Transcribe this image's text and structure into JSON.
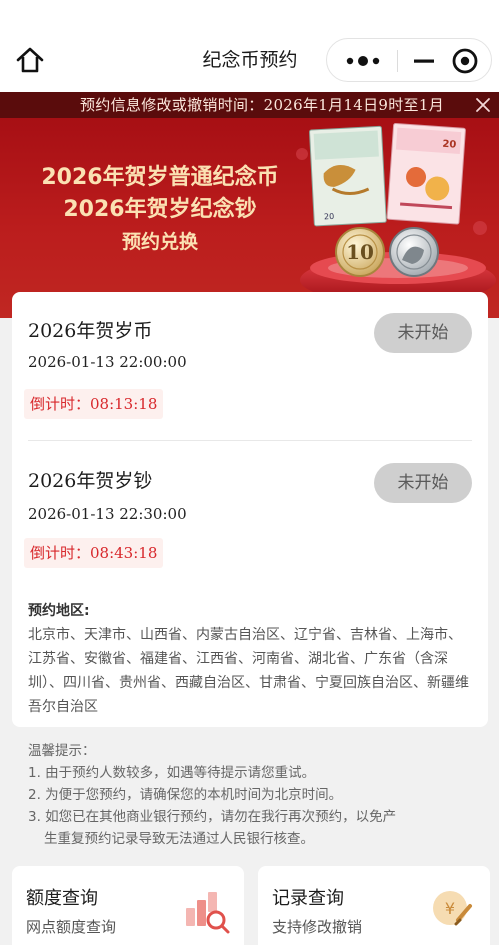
{
  "nav": {
    "title": "纪念币预约",
    "home_icon": "home-icon",
    "more_icon": "more-dots-icon",
    "minimize_icon": "minimize-icon",
    "close_icon": "target-close-icon"
  },
  "notice": {
    "text": "预约信息修改或撤销时间：2026年1月14日9时至1月",
    "close_icon": "close-icon"
  },
  "banner": {
    "line1": "2026年贺岁普通纪念币",
    "line2": "2026年贺岁纪念钞",
    "line3": "预约兑换",
    "coin_value": "10",
    "note_value": "20"
  },
  "appointments": [
    {
      "name": "2026年贺岁币",
      "time": "2026-01-13 22:00:00",
      "countdown": "倒计时：08:13:18",
      "status": "未开始"
    },
    {
      "name": "2026年贺岁钞",
      "time": "2026-01-13 22:30:00",
      "countdown": "倒计时：08:43:18",
      "status": "未开始"
    }
  ],
  "region": {
    "title": "预约地区:",
    "text": "北京市、天津市、山西省、内蒙古自治区、辽宁省、吉林省、上海市、江苏省、安徽省、福建省、江西省、河南省、湖北省、广东省（含深圳）、四川省、贵州省、西藏自治区、甘肃省、宁夏回族自治区、新疆维吾尔自治区"
  },
  "tips": {
    "title": "温馨提示：",
    "items": [
      "1. 由于预约人数较多，如遇等待提示请您重试。",
      "2. 为便于您预约，请确保您的本机时间为北京时间。",
      "3. 如您已在其他商业银行预约，请勿在我行再次预约，以免产",
      "生重复预约记录导致无法通过人民银行核查。"
    ]
  },
  "bottom_cards": [
    {
      "title": "额度查询",
      "subtitle": "网点额度查询",
      "icon": "quota-search-icon"
    },
    {
      "title": "记录查询",
      "subtitle": "支持修改撤销",
      "icon": "record-coin-icon"
    }
  ],
  "colors": {
    "brand_red": "#b3161a",
    "notice_bg": "#5a0c0c",
    "countdown_red": "#d8282c",
    "status_gray": "#cfcfcf",
    "banner_gold": "#fbe1b3"
  }
}
